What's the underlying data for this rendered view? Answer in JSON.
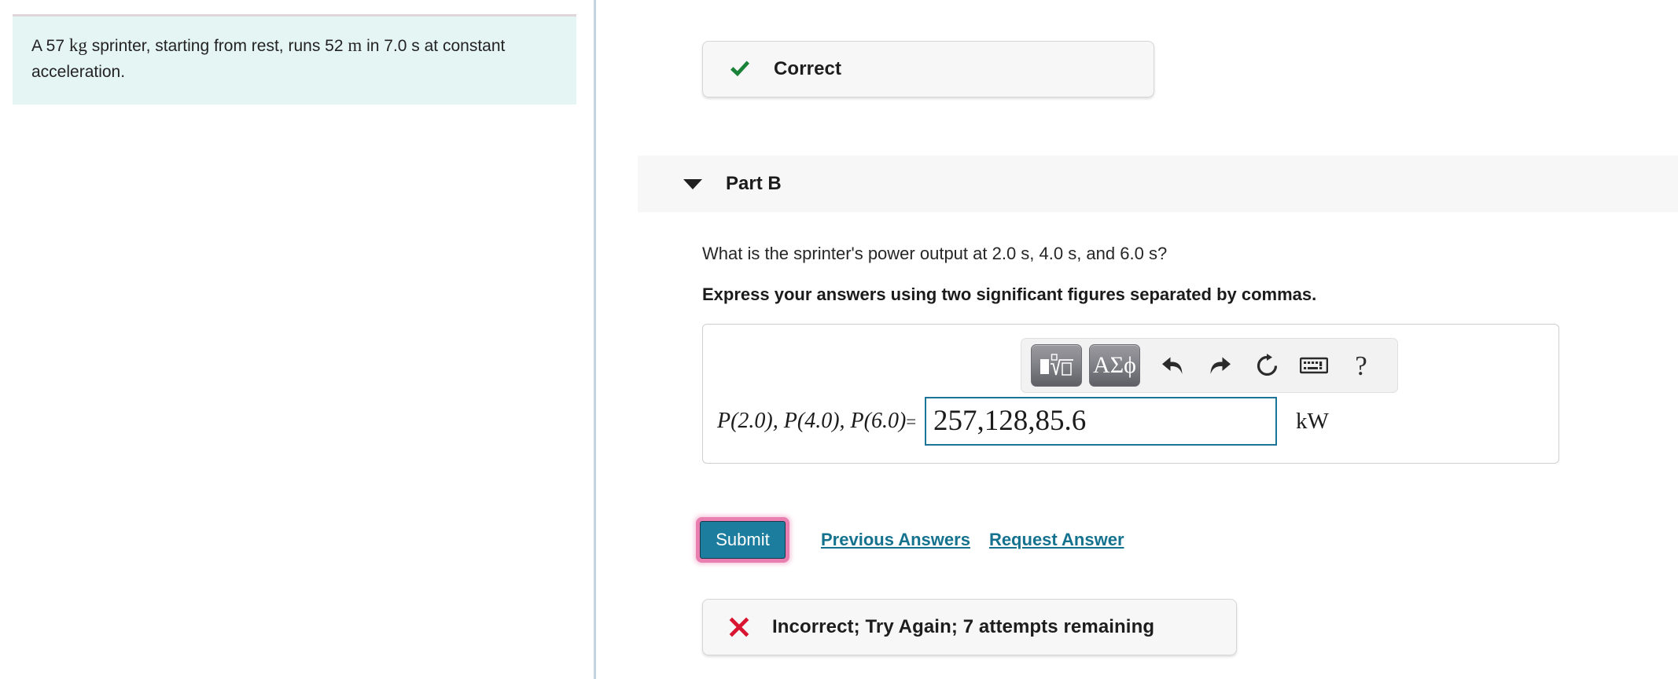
{
  "problem": {
    "text_before_mass": "A 57 ",
    "mass_unit": "kg",
    "text_mid": " sprinter, starting from rest, runs 52 ",
    "distance_unit": "m",
    "text_after": " in 7.0 s at constant acceleration.",
    "full_text": "A 57 kg sprinter, starting from rest, runs 52 m in 7.0 s at constant acceleration."
  },
  "correct_banner": {
    "icon": "check-icon",
    "label": "Correct",
    "color": "#1b8239"
  },
  "part": {
    "toggle_icon": "chevron-down-icon",
    "title": "Part B",
    "question": "What is the sprinter's power output at 2.0 s, 4.0 s, and 6.0 s?",
    "instruction": "Express your answers using two significant figures separated by commas."
  },
  "toolbar": {
    "buttons": [
      {
        "name": "math-template-button",
        "icon": "math-template-icon",
        "label": ""
      },
      {
        "name": "greek-letters-button",
        "icon": "greek-symbols-icon",
        "label": "ΑΣϕ"
      },
      {
        "name": "undo-button",
        "icon": "undo-icon",
        "label": ""
      },
      {
        "name": "redo-button",
        "icon": "redo-icon",
        "label": ""
      },
      {
        "name": "reset-button",
        "icon": "reset-icon",
        "label": ""
      },
      {
        "name": "keyboard-button",
        "icon": "keyboard-icon",
        "label": ""
      },
      {
        "name": "help-button",
        "icon": "help-icon",
        "label": "?"
      }
    ]
  },
  "answer": {
    "prefix_p1": "P",
    "prefix_a1": "(2.0),",
    "prefix_p2": "P",
    "prefix_a2": "(4.0),",
    "prefix_p3": "P",
    "prefix_a3": "(6.0)",
    "equals": "=",
    "value": "257,128,85.6",
    "placeholder": "",
    "units": "kW",
    "focus_border_color": "#1a7596"
  },
  "actions": {
    "submit_label": "Submit",
    "previous_answers_label": "Previous Answers",
    "request_answer_label": "Request Answer",
    "submit_color": "#1d7d9e",
    "focus_ring_color": "#e87fb0",
    "link_color": "#15728f"
  },
  "incorrect_banner": {
    "icon": "x-mark-icon",
    "label": "Incorrect; Try Again; 7 attempts remaining",
    "color": "#d81530"
  }
}
